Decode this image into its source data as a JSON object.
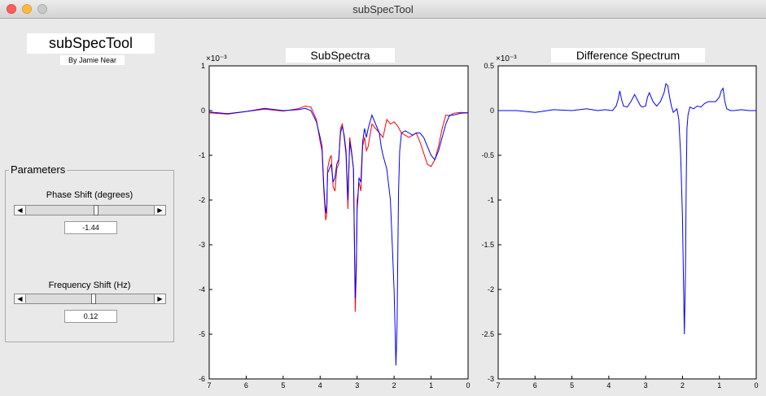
{
  "window": {
    "title": "subSpecTool"
  },
  "app": {
    "title": "subSpecTool",
    "author": "By Jamie Near"
  },
  "parameters": {
    "legend": "Parameters",
    "phase": {
      "label": "Phase Shift (degrees)",
      "value": "-1.44",
      "level": 0.55
    },
    "frequency": {
      "label": "Frequency Shift (Hz)",
      "value": "0.12",
      "level": 0.53
    }
  },
  "plots": {
    "subspectra": {
      "title": "SubSpectra",
      "exponent": "×10⁻³"
    },
    "difference": {
      "title": "Difference Spectrum",
      "exponent": "×10⁻³"
    }
  },
  "chart_data": [
    {
      "type": "line",
      "title": "SubSpectra",
      "x_reversed": true,
      "xlim": [
        0,
        7
      ],
      "ylim": [
        -6,
        1
      ],
      "xticks": [
        "7",
        "6",
        "5",
        "4",
        "3",
        "2",
        "1",
        "0"
      ],
      "yticks": [
        "1",
        "0",
        "-1",
        "-2",
        "-3",
        "-4",
        "-5",
        "-6"
      ],
      "series": [
        {
          "color": "#ff0000",
          "x": [
            7,
            6.5,
            6,
            5.5,
            5,
            4.6,
            4.4,
            4.25,
            4.1,
            4.0,
            3.95,
            3.9,
            3.85,
            3.82,
            3.8,
            3.75,
            3.7,
            3.65,
            3.6,
            3.55,
            3.5,
            3.45,
            3.4,
            3.35,
            3.3,
            3.25,
            3.2,
            3.15,
            3.1,
            3.05,
            3.02,
            3.0,
            2.98,
            2.95,
            2.9,
            2.85,
            2.8,
            2.75,
            2.7,
            2.6,
            2.5,
            2.4,
            2.3,
            2.2,
            2.1,
            2.0,
            1.95,
            1.9,
            1.8,
            1.7,
            1.6,
            1.5,
            1.4,
            1.3,
            1.2,
            1.1,
            1.0,
            0.9,
            0.8,
            0.7,
            0.6,
            0.5,
            0.4,
            0.2,
            0
          ],
          "y": [
            -0.05,
            -0.08,
            -0.02,
            0.03,
            -0.01,
            0.04,
            0.1,
            0.08,
            -0.2,
            -0.7,
            -0.9,
            -1.8,
            -2.45,
            -2.3,
            -1.3,
            -1.1,
            -1.0,
            -1.7,
            -1.8,
            -1.3,
            -1.2,
            -0.4,
            -0.3,
            -0.6,
            -1.0,
            -2.2,
            -0.6,
            -0.9,
            -1.3,
            -4.5,
            -3.5,
            -2.0,
            -1.9,
            -1.6,
            -1.8,
            -0.8,
            -0.6,
            -0.9,
            -0.8,
            -0.3,
            -0.4,
            -0.5,
            -0.6,
            -0.2,
            -0.3,
            -0.25,
            -0.3,
            -0.35,
            -0.5,
            -0.55,
            -0.6,
            -0.55,
            -0.5,
            -0.7,
            -0.95,
            -1.2,
            -1.25,
            -1.1,
            -0.8,
            -0.4,
            -0.1,
            -0.12,
            -0.06,
            -0.04,
            -0.05
          ]
        },
        {
          "color": "#0000ff",
          "x": [
            7,
            6.5,
            6,
            5.5,
            5,
            4.6,
            4.4,
            4.25,
            4.1,
            4.0,
            3.95,
            3.9,
            3.85,
            3.82,
            3.8,
            3.75,
            3.7,
            3.65,
            3.6,
            3.55,
            3.5,
            3.45,
            3.4,
            3.35,
            3.3,
            3.25,
            3.2,
            3.15,
            3.1,
            3.05,
            3.02,
            3.0,
            2.98,
            2.95,
            2.9,
            2.85,
            2.8,
            2.75,
            2.7,
            2.6,
            2.5,
            2.45,
            2.4,
            2.35,
            2.3,
            2.2,
            2.1,
            2.05,
            2.0,
            1.97,
            1.95,
            1.92,
            1.9,
            1.88,
            1.85,
            1.8,
            1.7,
            1.6,
            1.5,
            1.4,
            1.3,
            1.2,
            1.1,
            1.0,
            0.9,
            0.8,
            0.7,
            0.6,
            0.5,
            0.4,
            0.2,
            0
          ],
          "y": [
            -0.03,
            -0.07,
            -0.02,
            0.05,
            0.0,
            0.02,
            0.05,
            0.0,
            -0.25,
            -0.6,
            -0.8,
            -1.7,
            -2.3,
            -2.1,
            -1.4,
            -1.3,
            -1.2,
            -1.6,
            -1.5,
            -1.2,
            -1.1,
            -0.5,
            -0.35,
            -0.55,
            -0.9,
            -2.0,
            -0.7,
            -0.95,
            -1.3,
            -4.2,
            -3.4,
            -2.2,
            -2.0,
            -1.5,
            -1.6,
            -0.7,
            -0.4,
            -0.6,
            -0.4,
            -0.1,
            -0.3,
            -0.4,
            -0.5,
            -0.8,
            -1.0,
            -1.3,
            -2.0,
            -3.0,
            -4.0,
            -5.0,
            -5.7,
            -4.8,
            -3.2,
            -1.8,
            -0.9,
            -0.5,
            -0.45,
            -0.5,
            -0.55,
            -0.5,
            -0.5,
            -0.6,
            -0.8,
            -1.0,
            -1.1,
            -0.9,
            -0.6,
            -0.3,
            -0.1,
            -0.1,
            -0.06,
            -0.05
          ]
        }
      ]
    },
    {
      "type": "line",
      "title": "Difference Spectrum",
      "x_reversed": true,
      "xlim": [
        0,
        7
      ],
      "ylim": [
        -3,
        0.5
      ],
      "xticks": [
        "7",
        "6",
        "5",
        "4",
        "3",
        "2",
        "1",
        "0"
      ],
      "yticks": [
        "0.5",
        "0",
        "-0.5",
        "-1",
        "-1.5",
        "-2",
        "-2.5",
        "-3"
      ],
      "series": [
        {
          "color": "#0000ff",
          "x": [
            7,
            6.5,
            6,
            5.5,
            5,
            4.6,
            4.3,
            4.1,
            3.9,
            3.8,
            3.75,
            3.7,
            3.65,
            3.6,
            3.5,
            3.4,
            3.3,
            3.2,
            3.15,
            3.1,
            3.0,
            2.95,
            2.9,
            2.8,
            2.7,
            2.6,
            2.5,
            2.45,
            2.4,
            2.35,
            2.3,
            2.25,
            2.2,
            2.15,
            2.1,
            2.05,
            2.0,
            1.97,
            1.95,
            1.92,
            1.9,
            1.88,
            1.85,
            1.8,
            1.7,
            1.6,
            1.5,
            1.4,
            1.3,
            1.2,
            1.1,
            1.0,
            0.95,
            0.9,
            0.85,
            0.8,
            0.7,
            0.6,
            0.4,
            0.2,
            0
          ],
          "y": [
            0.0,
            0.0,
            -0.02,
            0.01,
            0.0,
            0.02,
            0.0,
            0.01,
            0.0,
            0.05,
            0.12,
            0.22,
            0.12,
            0.05,
            0.04,
            0.1,
            0.18,
            0.1,
            0.06,
            0.04,
            0.05,
            0.15,
            0.2,
            0.1,
            0.05,
            0.1,
            0.2,
            0.3,
            0.28,
            0.15,
            0.05,
            -0.02,
            0.0,
            0.02,
            -0.1,
            -0.5,
            -1.2,
            -2.0,
            -2.5,
            -1.8,
            -0.8,
            -0.2,
            -0.05,
            0.04,
            0.02,
            0.05,
            0.04,
            0.08,
            0.1,
            0.1,
            0.1,
            0.15,
            0.22,
            0.25,
            0.1,
            0.02,
            0.0,
            0.0,
            0.01,
            0.0,
            0.0
          ]
        }
      ]
    }
  ]
}
